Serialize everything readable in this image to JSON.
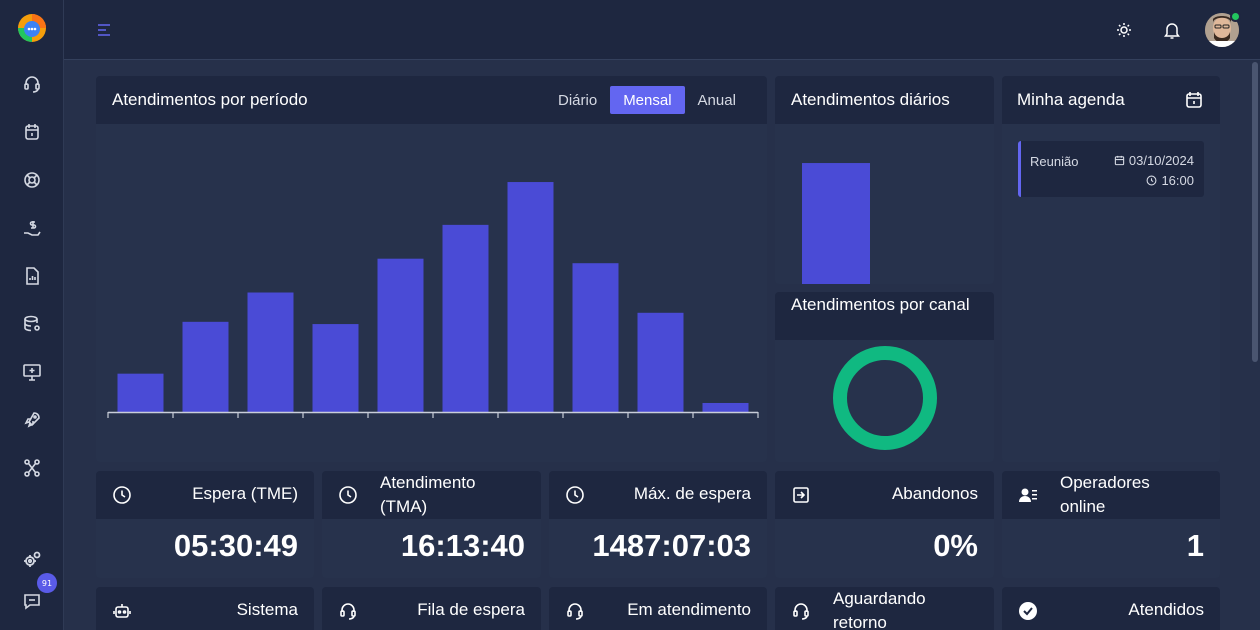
{
  "colors": {
    "accent": "#6366f1",
    "bar": "#4a4bd6",
    "donut": "#10b981",
    "online": "#22c55e",
    "background": "#26304a",
    "panel": "#1e2740"
  },
  "sidebar": {
    "items": [
      {
        "icon": "headset-icon"
      },
      {
        "icon": "calendar-icon"
      },
      {
        "icon": "lifebuoy-icon"
      },
      {
        "icon": "money-hand-icon"
      },
      {
        "icon": "report-icon"
      },
      {
        "icon": "database-settings-icon"
      },
      {
        "icon": "monitor-plus-icon"
      },
      {
        "icon": "rocket-icon"
      },
      {
        "icon": "workflow-icon"
      }
    ],
    "bottom": [
      {
        "icon": "gears-icon"
      },
      {
        "icon": "chat-icon",
        "badge": "91"
      }
    ]
  },
  "topbar": {
    "menu_icon": "menu-icon",
    "theme_icon": "sun-icon",
    "notification_icon": "bell-icon",
    "avatar": "user-avatar"
  },
  "period_chart": {
    "title": "Atendimentos por período",
    "tabs": [
      "Diário",
      "Mensal",
      "Anual"
    ],
    "active_tab": "Mensal"
  },
  "daily_chart": {
    "title": "Atendimentos diários"
  },
  "channel_chart": {
    "title": "Atendimentos por canal"
  },
  "agenda": {
    "title": "Minha agenda",
    "icon": "calendar-icon",
    "items": [
      {
        "label": "Reunião",
        "date": "03/10/2024",
        "time": "16:00"
      }
    ]
  },
  "stats": [
    {
      "label": "Espera (TME)",
      "value": "05:30:49",
      "icon": "clock-icon"
    },
    {
      "label": "Atendimento (TMA)",
      "value": "16:13:40",
      "icon": "clock-icon"
    },
    {
      "label": "Máx. de espera",
      "value": "1487:07:03",
      "icon": "clock-icon"
    },
    {
      "label": "Abandonos",
      "value": "0%",
      "icon": "exit-icon"
    },
    {
      "label": "Operadores online",
      "value": "1",
      "icon": "users-list-icon"
    }
  ],
  "stats_row2": [
    {
      "label": "Sistema",
      "icon": "robot-icon"
    },
    {
      "label": "Fila de espera",
      "icon": "headset-icon"
    },
    {
      "label": "Em atendimento",
      "icon": "headset-icon"
    },
    {
      "label": "Aguardando retorno",
      "icon": "headset-icon"
    },
    {
      "label": "Atendidos",
      "icon": "check-circle-icon"
    }
  ],
  "chart_data": [
    {
      "type": "bar",
      "categories": [
        "",
        "",
        "",
        "",
        "",
        "",
        "",
        "",
        "",
        ""
      ],
      "values": [
        17,
        40,
        53,
        39,
        68,
        83,
        102,
        66,
        44,
        4
      ],
      "ylim": [
        0,
        110
      ],
      "title": "Atendimentos por período",
      "xlabel": "",
      "ylabel": "",
      "grid": false
    },
    {
      "type": "bar",
      "categories": [
        "",
        ""
      ],
      "values": [
        103,
        1
      ],
      "ylim": [
        0,
        110
      ],
      "title": "Atendimentos diários",
      "xlabel": "",
      "ylabel": "",
      "grid": false
    },
    {
      "type": "pie",
      "categories": [
        ""
      ],
      "values": [
        100
      ],
      "title": "Atendimentos por canal"
    }
  ]
}
